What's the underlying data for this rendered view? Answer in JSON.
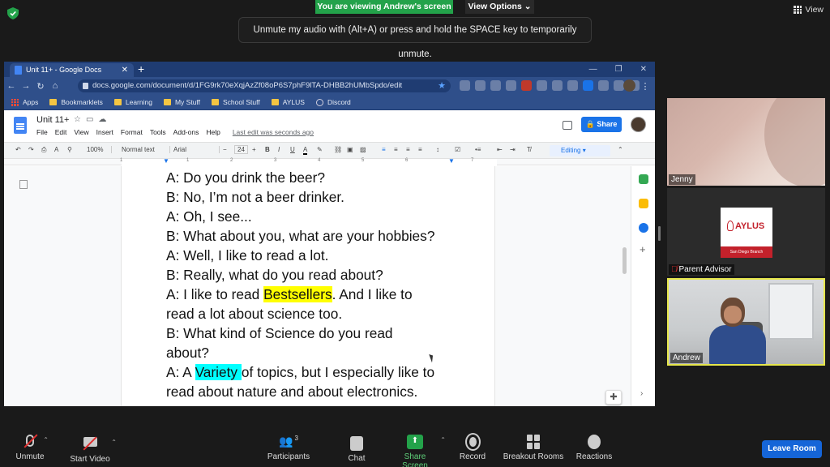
{
  "zoom": {
    "viewing_banner": "You are viewing Andrew's screen",
    "view_options": "View Options ⌄",
    "view_button": "View",
    "unmute_tip": "Unmute my audio with (Alt+A) or press and hold the SPACE key to temporarily unmute.",
    "participants": [
      {
        "name": "Jenny"
      },
      {
        "name": "Parent Advisor",
        "muted": true
      },
      {
        "name": "Andrew",
        "active_speaker": true
      }
    ],
    "bottom_bar": {
      "unmute": "Unmute",
      "start_video": "Start Video",
      "participants": "Participants",
      "participants_count": "3",
      "chat": "Chat",
      "share_screen": "Share Screen",
      "record": "Record",
      "breakout_rooms": "Breakout Rooms",
      "reactions": "Reactions",
      "leave_room": "Leave Room"
    },
    "colors": {
      "share_green": "#23a24a",
      "leave_blue": "#1565d8",
      "active_speaker_border": "#e6e64b"
    }
  },
  "browser": {
    "tab_title": "Unit 11+ - Google Docs",
    "url": "docs.google.com/document/d/1FG9rk70eXqjAzZf08oP6S7phF9lTA-DHBB2hUMbSpdo/edit",
    "bookmarks": [
      "Apps",
      "Bookmarklets",
      "Learning",
      "My Stuff",
      "School Stuff",
      "AYLUS",
      "Discord"
    ]
  },
  "docs": {
    "title": "Unit 11+",
    "menus": [
      "File",
      "Edit",
      "View",
      "Insert",
      "Format",
      "Tools",
      "Add-ons",
      "Help"
    ],
    "last_edit": "Last edit was seconds ago",
    "share_label": "Share",
    "toolbar": {
      "zoom": "100%",
      "style": "Normal text",
      "font": "Arial",
      "font_size": "24",
      "mode": "Editing"
    },
    "ruler_numbers": [
      "1",
      "1",
      "2",
      "3",
      "4",
      "5",
      "6",
      "7"
    ],
    "lines": [
      {
        "text": "A: Do you drink the beer?"
      },
      {
        "text": "B: No, I’m not a beer drinker."
      },
      {
        "text": "A: Oh, I see..."
      },
      {
        "text": "B: What about you, what are your hobbies?"
      },
      {
        "text": "A: Well, I like to read a lot."
      },
      {
        "text": "B: Really, what do you read about?"
      },
      {
        "pre": "A: I like to read ",
        "highlight": "Bestsellers",
        "post": ". And I like to",
        "highlight_color": "yellow"
      },
      {
        "text": "read a lot about science too."
      },
      {
        "text": "B: What kind of Science do you read"
      },
      {
        "text": "about?"
      },
      {
        "pre": "A: A ",
        "highlight": "Variety ",
        "post": "of topics, but I especially like to",
        "highlight_color": "cyan"
      },
      {
        "text": "read about nature and about electronics."
      }
    ],
    "highlight_colors": {
      "yellow": "#ffff00",
      "cyan": "#00ffff"
    }
  },
  "aylus_logo": {
    "title": "AYLUS",
    "branch": "San Diego Branch"
  }
}
